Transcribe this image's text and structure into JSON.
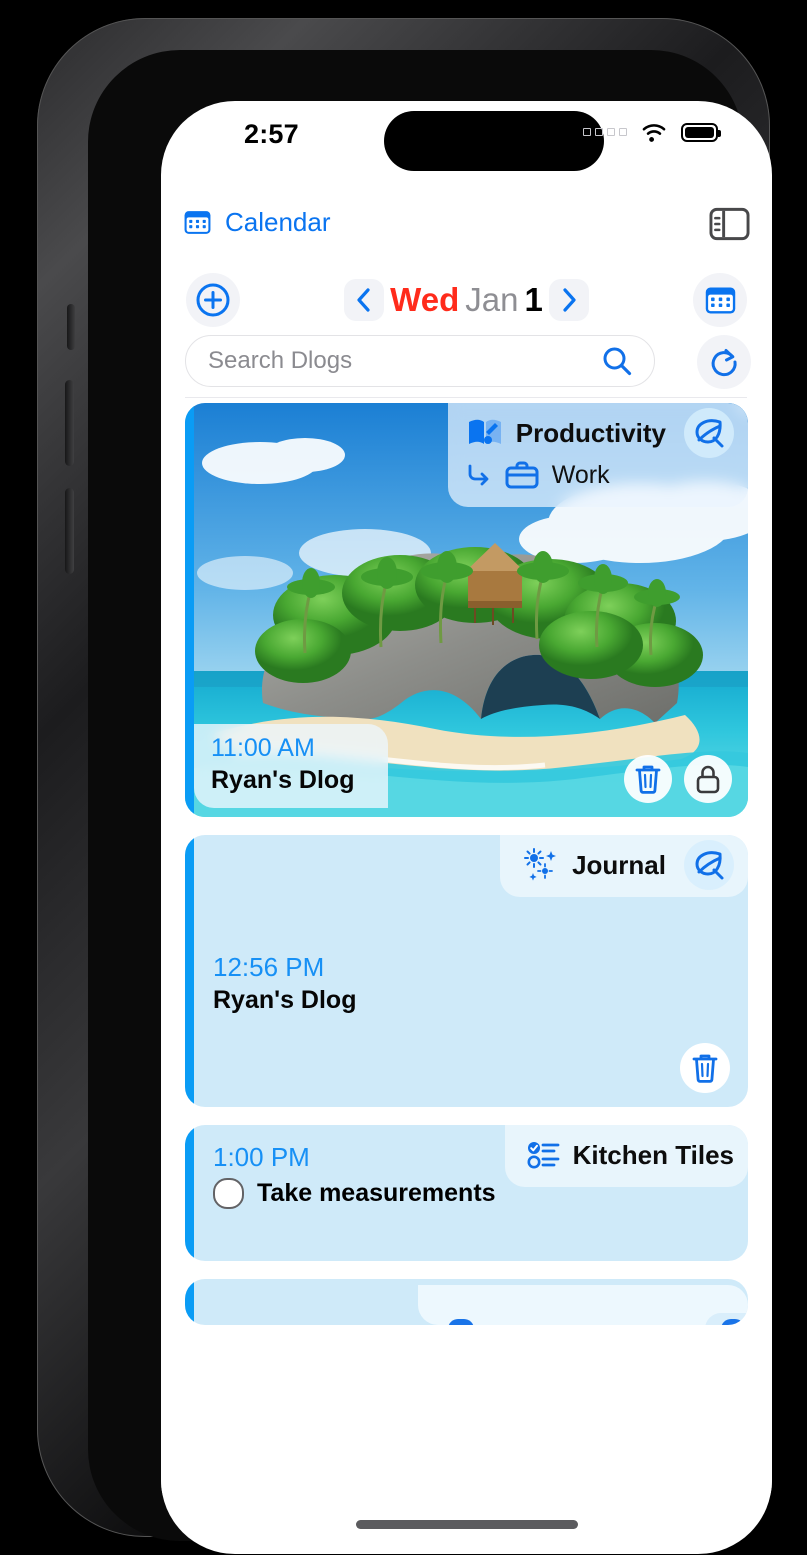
{
  "status_bar": {
    "time": "2:57",
    "wifi_icon": "wifi-icon",
    "battery_icon": "battery-icon",
    "signal_icon": "signal-dots-icon"
  },
  "app_header": {
    "calendar_icon": "calendar-icon",
    "title": "Calendar",
    "sidebar_toggle_icon": "sidebar-toggle-icon"
  },
  "toolbar": {
    "add_icon": "plus-circle-icon",
    "prev_icon": "chevron-left-icon",
    "next_icon": "chevron-right-icon",
    "weekday": "Wed",
    "month": "Jan",
    "day": "1",
    "calendar_button_icon": "calendar-icon"
  },
  "search": {
    "placeholder": "Search Dlogs",
    "value": "",
    "search_icon": "search-icon",
    "refresh_icon": "refresh-icon"
  },
  "cards": [
    {
      "type": "photo",
      "badge_title": "Productivity",
      "badge_title_icon": "book-wrench-icon",
      "badge_sub": "Work",
      "badge_sub_icon": "briefcase-icon",
      "badge_sub_arrow_icon": "arrow-turn-right-icon",
      "leaf_icon": "leaf-icon",
      "time": "11:00 AM",
      "title": "Ryan's Dlog",
      "image_alt": "tropical-island-arch-photo",
      "actions": [
        "trash-icon",
        "lock-icon"
      ]
    },
    {
      "type": "plain",
      "badge_title": "Journal",
      "badge_title_icon": "sparkles-icon",
      "leaf_icon": "leaf-icon",
      "time": "12:56 PM",
      "title": "Ryan's Dlog",
      "actions": [
        "trash-icon"
      ]
    },
    {
      "type": "task",
      "badge_title": "Kitchen Tiles",
      "badge_title_icon": "checklist-icon",
      "time": "1:00 PM",
      "task": "Take measurements",
      "checkbox_state": "unchecked"
    },
    {
      "type": "partial",
      "badge_title": "",
      "title": ""
    }
  ],
  "colors": {
    "accent_blue": "#0a9cf5",
    "link_blue": "#0a74f0",
    "weekday_red": "#ff2b1b",
    "card_blue": "#cfeaf9",
    "time_blue": "#1790f5",
    "muted_gray": "#8e8e93"
  },
  "home_indicator": "home-indicator"
}
